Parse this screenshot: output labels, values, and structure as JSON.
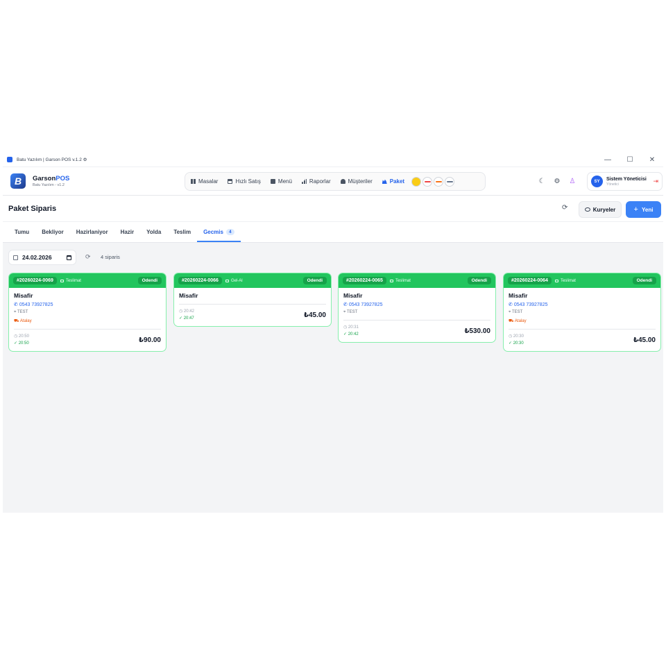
{
  "window": {
    "title": "Batu Yazılım | Garson POS v.1.2 ⚙",
    "controls": [
      "—",
      "☐",
      "✕"
    ]
  },
  "brand": {
    "logo_letter": "B",
    "name_part1": "Garson",
    "name_part2": "POS",
    "subtitle": "Batu Yazılım - v1.2"
  },
  "nav": {
    "items": [
      {
        "label": "Masalar",
        "icon": "grid-icon"
      },
      {
        "label": "Hızlı Satış",
        "icon": "basket-icon"
      },
      {
        "label": "Menü",
        "icon": "book-icon"
      },
      {
        "label": "Raporlar",
        "icon": "chart-icon"
      },
      {
        "label": "Müşteriler",
        "icon": "users-icon"
      },
      {
        "label": "Paket",
        "icon": "package-icon",
        "active": true
      }
    ],
    "platforms": [
      "yemeksepeti",
      "trendyol",
      "getir",
      "migros"
    ]
  },
  "header_icons": [
    "moon-icon",
    "gear-icon",
    "people-icon"
  ],
  "user": {
    "initials": "SY",
    "name": "Sistem Yöneticisi",
    "role": "Yönetici"
  },
  "page": {
    "title": "Paket Siparis",
    "kuryeler_label": "Kuryeler",
    "yeni_label": "Yeni"
  },
  "tabs": [
    {
      "label": "Tumu"
    },
    {
      "label": "Bekliyor"
    },
    {
      "label": "Hazirlaniyor"
    },
    {
      "label": "Hazir"
    },
    {
      "label": "Yolda"
    },
    {
      "label": "Teslim"
    },
    {
      "label": "Gecmis",
      "count": "4",
      "active": true
    }
  ],
  "filter": {
    "date": "24.02.2026",
    "order_count": "4 siparis"
  },
  "orders": [
    {
      "no": "#20260224-0069",
      "type": "Teslimat",
      "status": "Odendi",
      "customer": "Misafir",
      "phone": "0543 73927825",
      "address": "TEST",
      "courier": "Atalay",
      "time1": "20:50",
      "time2": "20:50",
      "amount": "₺90.00"
    },
    {
      "no": "#20260224-0066",
      "type": "Gel-Al",
      "status": "Odendi",
      "customer": "Misafir",
      "time1": "20:42",
      "time2": "20:47",
      "amount": "₺45.00"
    },
    {
      "no": "#20260224-0065",
      "type": "Teslimat",
      "status": "Odendi",
      "customer": "Misafir",
      "phone": "0543 73927825",
      "address": "TEST",
      "time1": "20:31",
      "time2": "20:42",
      "amount": "₺530.00"
    },
    {
      "no": "#20260224-0064",
      "type": "Teslimat",
      "status": "Odendi",
      "customer": "Misafir",
      "phone": "0543 73927825",
      "address": "TEST",
      "courier": "Atalay",
      "time1": "20:30",
      "time2": "20:30",
      "amount": "₺45.00"
    }
  ],
  "colors": {
    "primary": "#3b82f6",
    "success": "#22c55e",
    "success_dark": "#16a34a",
    "courier": "#ea580c",
    "background": "#f3f4f6"
  }
}
